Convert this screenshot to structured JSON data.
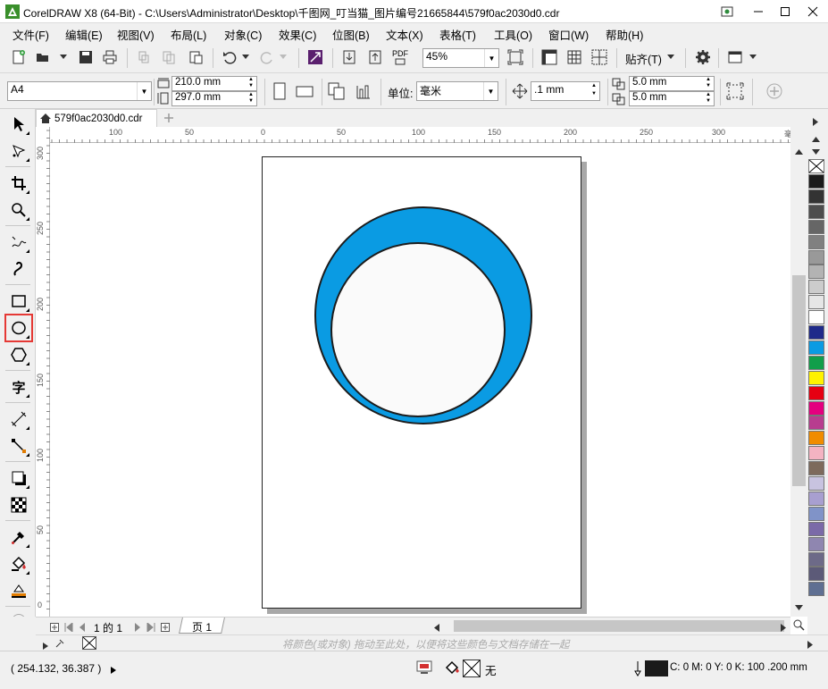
{
  "window": {
    "title": "CorelDRAW X8 (64-Bit) - C:\\Users\\Administrator\\Desktop\\千图网_叮当猫_图片编号21665844\\579f0ac2030d0.cdr"
  },
  "menu": {
    "file": "文件(F)",
    "edit": "编辑(E)",
    "view": "视图(V)",
    "layout": "布局(L)",
    "object": "对象(C)",
    "effects": "效果(C)",
    "bitmaps": "位图(B)",
    "text": "文本(X)",
    "table": "表格(T)",
    "tools": "工具(O)",
    "window": "窗口(W)",
    "help": "帮助(H)"
  },
  "standard_toolbar": {
    "pdf_label": "PDF",
    "zoom_value": "45%",
    "snap_label": "贴齐(T)"
  },
  "property_bar": {
    "page_size": "A4",
    "width": "210.0 mm",
    "height": "297.0 mm",
    "units_label": "单位:",
    "units_value": "毫米",
    "nudge": ".1 mm",
    "dup_x": "5.0 mm",
    "dup_y": "5.0 mm"
  },
  "document": {
    "tab_name": "579f0ac2030d0.cdr",
    "page_tab": "页 1",
    "page_count": "1 的 1",
    "shapes": {
      "outer_fill": "#0a9be3",
      "inner_fill": "#fafafa",
      "stroke": "#1c1c1c"
    }
  },
  "rulers": {
    "h_labels": [
      "100",
      "50",
      "0",
      "50",
      "100",
      "150",
      "200",
      "250",
      "300"
    ],
    "h_unit": "毫米",
    "v_labels": [
      "300",
      "250",
      "200",
      "150",
      "100",
      "50",
      "0"
    ]
  },
  "palette": {
    "colors": [
      "#1a1a1a",
      "#333333",
      "#4d4d4d",
      "#666666",
      "#808080",
      "#999999",
      "#b3b3b3",
      "#cccccc",
      "#e6e6e6",
      "#ffffff",
      "#1f2a8a",
      "#0a9be3",
      "#119e4a",
      "#fff200",
      "#e60012",
      "#e4007f",
      "#b83d8f",
      "#f08c00",
      "#f4b3c2",
      "#7d6a5c",
      "#c8c3e0",
      "#a89fd0",
      "#8093c8",
      "#7b6aa8",
      "#8f86b0",
      "#6d6a88",
      "#5c5a78",
      "#5f6f92"
    ]
  },
  "palette_hint": "将颜色(或对象) 拖动至此处，以便将这些颜色与文档存储在一起",
  "status": {
    "coords": "( 254.132, 36.387 )",
    "fill_label": "无",
    "outline_info": "C: 0 M: 0 Y: 0 K: 100  .200 mm"
  }
}
